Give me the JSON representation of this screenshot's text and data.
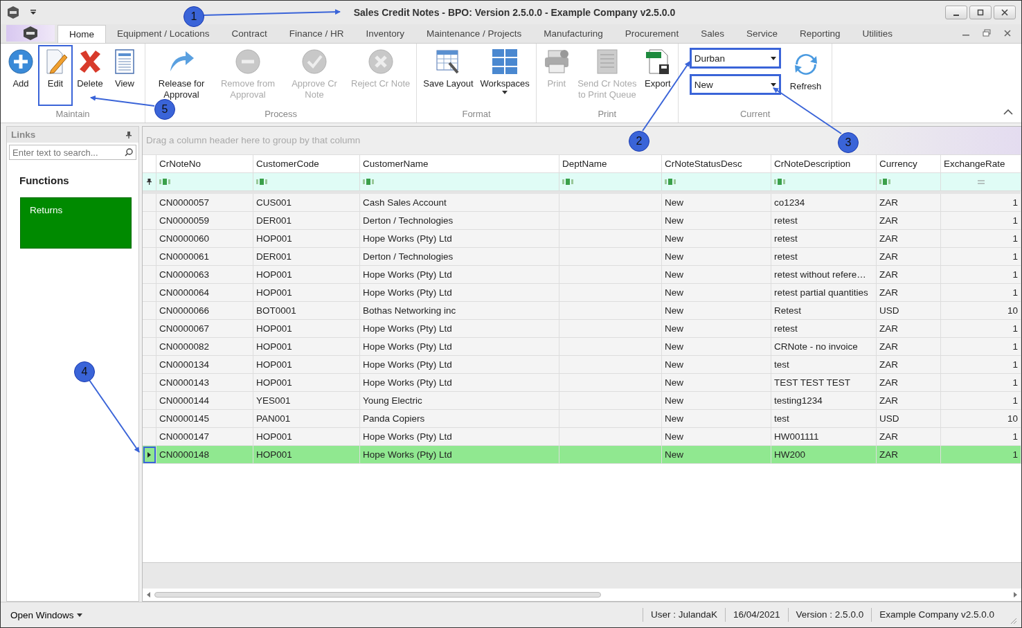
{
  "window": {
    "title": "Sales Credit Notes - BPO: Version 2.5.0.0 - Example Company v2.5.0.0"
  },
  "tabs": [
    {
      "label": "Home",
      "selected": true
    },
    {
      "label": "Equipment / Locations",
      "selected": false
    },
    {
      "label": "Contract",
      "selected": false
    },
    {
      "label": "Finance / HR",
      "selected": false
    },
    {
      "label": "Inventory",
      "selected": false
    },
    {
      "label": "Maintenance / Projects",
      "selected": false
    },
    {
      "label": "Manufacturing",
      "selected": false
    },
    {
      "label": "Procurement",
      "selected": false
    },
    {
      "label": "Sales",
      "selected": false
    },
    {
      "label": "Service",
      "selected": false
    },
    {
      "label": "Reporting",
      "selected": false
    },
    {
      "label": "Utilities",
      "selected": false
    }
  ],
  "ribbon": {
    "groups": [
      {
        "label": "Maintain",
        "buttons": [
          {
            "label": "Add",
            "disabled": false,
            "marked": false
          },
          {
            "label": "Edit",
            "disabled": false,
            "marked": true
          },
          {
            "label": "Delete",
            "disabled": false,
            "marked": false
          },
          {
            "label": "View",
            "disabled": false,
            "marked": false
          }
        ]
      },
      {
        "label": "Process",
        "buttons": [
          {
            "label": "Release for Approval",
            "disabled": false,
            "marked": false
          },
          {
            "label": "Remove from Approval",
            "disabled": true,
            "marked": false
          },
          {
            "label": "Approve Cr Note",
            "disabled": true,
            "marked": false
          },
          {
            "label": "Reject Cr Note",
            "disabled": true,
            "marked": false
          }
        ]
      },
      {
        "label": "Format",
        "buttons": [
          {
            "label": "Save Layout",
            "disabled": false,
            "marked": false
          },
          {
            "label": "Workspaces",
            "disabled": false,
            "marked": false
          }
        ]
      },
      {
        "label": "Print",
        "buttons": [
          {
            "label": "Print",
            "disabled": true,
            "marked": false
          },
          {
            "label": "Send Cr Notes to Print Queue",
            "disabled": true,
            "marked": false
          },
          {
            "label": "Export",
            "disabled": false,
            "marked": false
          }
        ]
      }
    ],
    "current": {
      "label": "Current",
      "fields": [
        {
          "value": "Durban",
          "marked": true
        },
        {
          "value": "New",
          "marked": true
        }
      ],
      "refresh": "Refresh"
    }
  },
  "links": {
    "title": "Links",
    "search": {
      "placeholder": "Enter text to search..."
    },
    "heading": "Functions",
    "tiles": [
      "Returns"
    ]
  },
  "grid": {
    "group_hint": "Drag a column header here to group by that column",
    "columns": [
      "CrNoteNo",
      "CustomerCode",
      "CustomerName",
      "DeptName",
      "CrNoteStatusDesc",
      "CrNoteDescription",
      "Currency",
      "ExchangeRate"
    ],
    "rows": [
      {
        "cells": [
          "CN0000057",
          "CUS001",
          "Cash Sales Account",
          "",
          "New",
          "co1234",
          "ZAR",
          "1"
        ],
        "selected": false,
        "marked": false
      },
      {
        "cells": [
          "CN0000059",
          "DER001",
          "Derton / Technologies",
          "",
          "New",
          "retest",
          "ZAR",
          "1"
        ],
        "selected": false,
        "marked": false
      },
      {
        "cells": [
          "CN0000060",
          "HOP001",
          "Hope Works (Pty) Ltd",
          "",
          "New",
          "retest",
          "ZAR",
          "1"
        ],
        "selected": false,
        "marked": false
      },
      {
        "cells": [
          "CN0000061",
          "DER001",
          "Derton / Technologies",
          "",
          "New",
          "retest",
          "ZAR",
          "1"
        ],
        "selected": false,
        "marked": false
      },
      {
        "cells": [
          "CN0000063",
          "HOP001",
          "Hope Works (Pty) Ltd",
          "",
          "New",
          "retest without refere…",
          "ZAR",
          "1"
        ],
        "selected": false,
        "marked": false
      },
      {
        "cells": [
          "CN0000064",
          "HOP001",
          "Hope Works (Pty) Ltd",
          "",
          "New",
          "retest partial quantities",
          "ZAR",
          "1"
        ],
        "selected": false,
        "marked": false
      },
      {
        "cells": [
          "CN0000066",
          "BOT0001",
          "Bothas Networking inc",
          "",
          "New",
          "Retest",
          "USD",
          "10"
        ],
        "selected": false,
        "marked": false
      },
      {
        "cells": [
          "CN0000067",
          "HOP001",
          "Hope Works (Pty) Ltd",
          "",
          "New",
          "retest",
          "ZAR",
          "1"
        ],
        "selected": false,
        "marked": false
      },
      {
        "cells": [
          "CN0000082",
          "HOP001",
          "Hope Works (Pty) Ltd",
          "",
          "New",
          "CRNote - no invoice",
          "ZAR",
          "1"
        ],
        "selected": false,
        "marked": false
      },
      {
        "cells": [
          "CN0000134",
          "HOP001",
          "Hope Works (Pty) Ltd",
          "",
          "New",
          "test",
          "ZAR",
          "1"
        ],
        "selected": false,
        "marked": false
      },
      {
        "cells": [
          "CN0000143",
          "HOP001",
          "Hope Works (Pty) Ltd",
          "",
          "New",
          "TEST TEST TEST",
          "ZAR",
          "1"
        ],
        "selected": false,
        "marked": false
      },
      {
        "cells": [
          "CN0000144",
          "YES001",
          "Young Electric",
          "",
          "New",
          "testing1234",
          "ZAR",
          "1"
        ],
        "selected": false,
        "marked": false
      },
      {
        "cells": [
          "CN0000145",
          "PAN001",
          "Panda Copiers",
          "",
          "New",
          "test",
          "USD",
          "10"
        ],
        "selected": false,
        "marked": false
      },
      {
        "cells": [
          "CN0000147",
          "HOP001",
          "Hope Works (Pty) Ltd",
          "",
          "New",
          "HW001111",
          "ZAR",
          "1"
        ],
        "selected": false,
        "marked": false
      },
      {
        "cells": [
          "CN0000148",
          "HOP001",
          "Hope Works (Pty) Ltd",
          "",
          "New",
          "HW200",
          "ZAR",
          "1"
        ],
        "selected": true,
        "marked": true
      }
    ]
  },
  "status_bar": {
    "open_windows": "Open Windows",
    "items": [
      "User : JulandaK",
      "16/04/2021",
      "Version : 2.5.0.0",
      "Example Company v2.5.0.0"
    ]
  },
  "callouts": [
    "1",
    "2",
    "3",
    "4",
    "5"
  ]
}
